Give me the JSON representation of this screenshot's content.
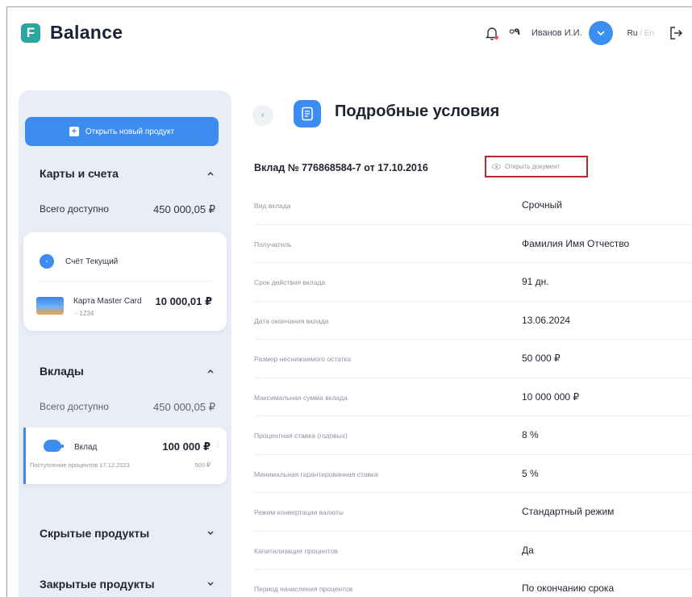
{
  "header": {
    "logo_letter": "F",
    "logo_text": "Balance",
    "username": "Иванов И.И.",
    "lang_ru": "Ru",
    "lang_sep": " / ",
    "lang_en": "En",
    "glasses_glyph": "০٩"
  },
  "sidebar": {
    "new_product_label": "Открыть новый продукт",
    "cards_section": {
      "title": "Карты и счета",
      "total_label": "Всего доступно",
      "total_amount": "450 000,05 ₽",
      "account_label": "Счёт Текущий",
      "card_name": "Карта Master Card",
      "card_number": "·· 1234",
      "card_amount": "10 000,01 ₽"
    },
    "deposits_section": {
      "title": "Вклады",
      "total_label": "Всего доступно",
      "total_amount": "450 000,05 ₽",
      "deposit_name": "Вклад",
      "deposit_amount": "100 000 ₽",
      "deposit_sub": "Поступление процентов 17.12.2023",
      "deposit_sub_amount": "500 ₽"
    },
    "hidden_title": "Скрытые продукты",
    "closed_title": "Закрытые продукты"
  },
  "main": {
    "back_glyph": "‹",
    "title": "Подробные условия",
    "contract": "Вклад № 776868584-7 от 17.10.2016",
    "open_doc_label": "Открыть документ",
    "rows": [
      {
        "label": "Вид вклада",
        "value": "Срочный"
      },
      {
        "label": "Получатель",
        "value": "Фамилия Имя Отчество"
      },
      {
        "label": "Срок действия вклада",
        "value": "91 дн."
      },
      {
        "label": "Дата окончания вклада",
        "value": "13.06.2024"
      },
      {
        "label": "Размер неснижаемого остатка",
        "value": "50 000 ₽"
      },
      {
        "label": "Максимальная сумма вклада",
        "value": "10 000 000 ₽"
      },
      {
        "label": "Процентная ставка (годовых)",
        "value": "8 %"
      },
      {
        "label": "Минимальная гарантированная ставка",
        "value": "5 %"
      },
      {
        "label": "Режим конвертации валюты",
        "value": "Стандартный режим"
      },
      {
        "label": "Капитализация процентов",
        "value": "Да"
      },
      {
        "label": "Период начисления процентов",
        "value": "По окончанию срока"
      }
    ]
  },
  "colors": {
    "accent": "#3d8cf0",
    "logo": "#2aa6a0",
    "highlight_border": "#b8282e",
    "sidebar_bg": "#e9edf5"
  }
}
